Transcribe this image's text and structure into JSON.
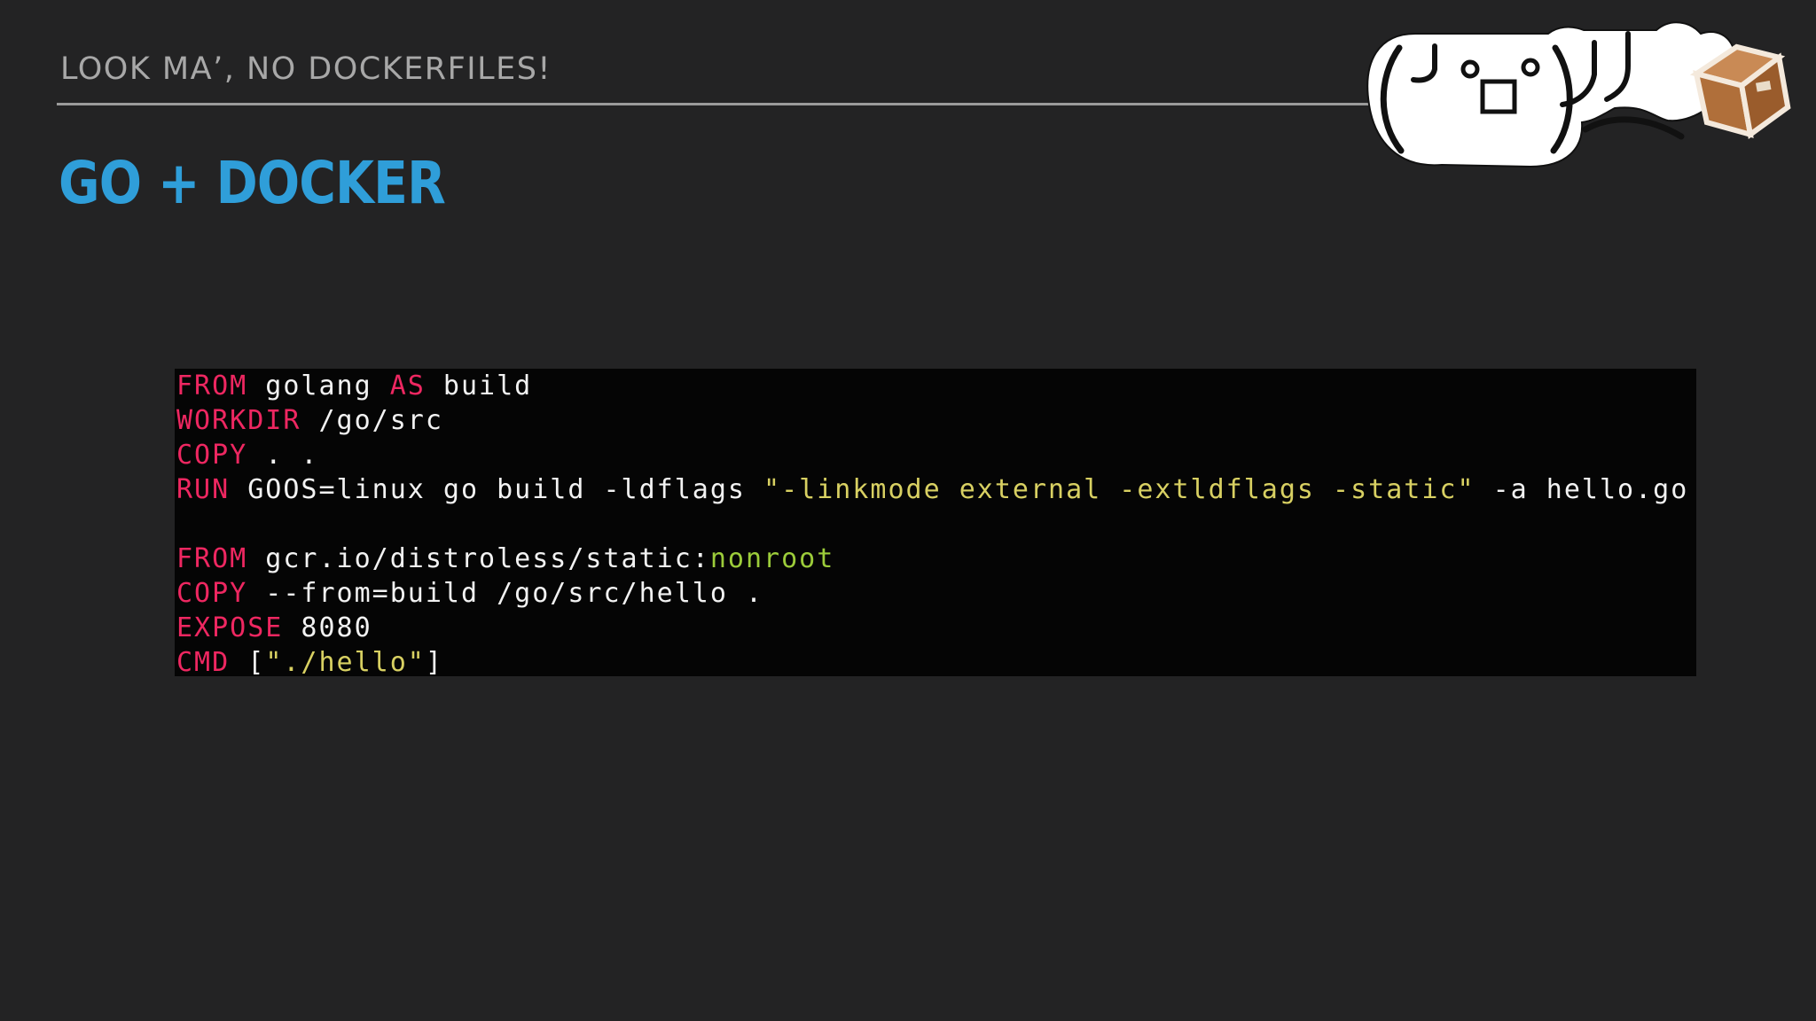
{
  "slide": {
    "section_label": "LOOK MA’, NO DOCKERFILES!",
    "title": "GO + DOCKER"
  },
  "logo": {
    "icon": "flipping-box-kaomoji-logo",
    "text": "(╯°□°)╯"
  },
  "colors": {
    "background": "#232324",
    "title": "#2f9ed9",
    "keyword": "#ee2761",
    "string": "#d8d062",
    "tag": "#9ccc3a",
    "code_background": "#050505"
  },
  "code": {
    "language": "Dockerfile",
    "lines": [
      {
        "kw": "FROM",
        "a": " golang ",
        "kw2": "AS",
        "b": " build"
      },
      {
        "kw": "WORKDIR",
        "a": " /go/src"
      },
      {
        "kw": "COPY",
        "a": " . ."
      },
      {
        "kw": "RUN",
        "a": " GOOS=linux go build -ldflags ",
        "str": "\"-linkmode external -extldflags -static\"",
        "b": " -a hello.go"
      },
      {
        "blank": ""
      },
      {
        "kw": "FROM",
        "a": " gcr.io/distroless/static:",
        "tag": "nonroot"
      },
      {
        "kw": "COPY",
        "a": " --from=build /go/src/hello ."
      },
      {
        "kw": "EXPOSE",
        "a": " 8080"
      },
      {
        "kw": "CMD",
        "a": " [",
        "str": "\"./hello\"",
        "b": "]"
      }
    ]
  }
}
